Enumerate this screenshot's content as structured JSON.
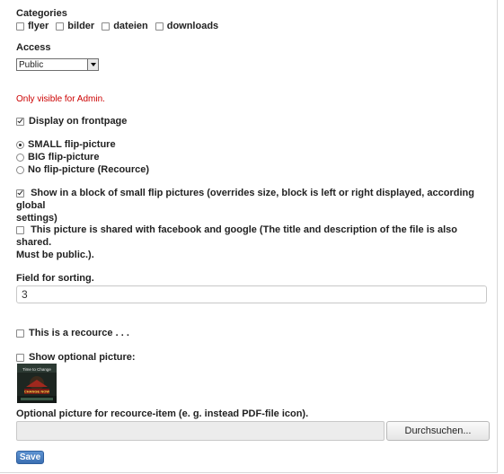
{
  "categories": {
    "label": "Categories",
    "options": [
      {
        "label": "flyer",
        "checked": false
      },
      {
        "label": "bilder",
        "checked": false
      },
      {
        "label": "dateien",
        "checked": false
      },
      {
        "label": "downloads",
        "checked": false
      }
    ]
  },
  "access": {
    "label": "Access",
    "selected": "Public",
    "note": "Only visible for Admin.",
    "note_color": "#cc0000"
  },
  "frontpage": {
    "label": "Display on frontpage",
    "checked": true
  },
  "flip_picture": {
    "options": [
      {
        "label": "SMALL flip-picture",
        "selected": true
      },
      {
        "label": "BIG flip-picture",
        "selected": false
      },
      {
        "label": "No flip-picture (Recource)",
        "selected": false
      }
    ]
  },
  "small_block": {
    "line1": "Show in a block of small flip pictures (overrides size, block is left or right displayed, according global",
    "line2": "settings)",
    "checked": true
  },
  "shared": {
    "line1": "This picture is shared with facebook and google (The title and description of the file is also shared.",
    "line2": "Must be public.).",
    "checked": false
  },
  "sorting": {
    "label": "Field for sorting.",
    "value": "3"
  },
  "recource": {
    "label": "This is a recource . . .",
    "checked": false
  },
  "optional_picture": {
    "label": "Show optional picture:",
    "checked": false,
    "thumb_text_top": "Time to Change",
    "thumb_text_bottom": "CHANGE NOW"
  },
  "upload": {
    "label": "Optional picture for recource-item (e. g. instead PDF-file icon).",
    "browse_label": "Durchsuchen..."
  },
  "save_label": "Save",
  "colors": {
    "accent": "#3b6fb2",
    "warning": "#cc0000"
  }
}
